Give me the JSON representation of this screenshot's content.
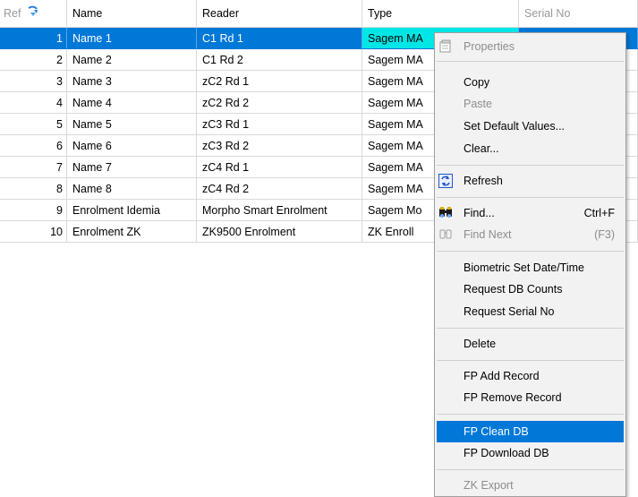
{
  "columns": {
    "ref": "Ref",
    "name": "Name",
    "reader": "Reader",
    "type": "Type",
    "serial": "Serial No"
  },
  "rows": [
    {
      "ref": "1",
      "name": "Name 1",
      "reader": "C1 Rd 1",
      "type": "Sagem MA"
    },
    {
      "ref": "2",
      "name": "Name 2",
      "reader": "C1 Rd 2",
      "type": "Sagem MA"
    },
    {
      "ref": "3",
      "name": "Name 3",
      "reader": "zC2 Rd 1",
      "type": "Sagem MA"
    },
    {
      "ref": "4",
      "name": "Name 4",
      "reader": "zC2 Rd 2",
      "type": "Sagem MA"
    },
    {
      "ref": "5",
      "name": "Name 5",
      "reader": "zC3 Rd 1",
      "type": "Sagem MA"
    },
    {
      "ref": "6",
      "name": "Name 6",
      "reader": "zC3 Rd 2",
      "type": "Sagem MA"
    },
    {
      "ref": "7",
      "name": "Name 7",
      "reader": "zC4 Rd 1",
      "type": "Sagem MA"
    },
    {
      "ref": "8",
      "name": "Name 8",
      "reader": "zC4 Rd 2",
      "type": "Sagem MA"
    },
    {
      "ref": "9",
      "name": "Enrolment Idemia",
      "reader": "Morpho Smart Enrolment",
      "type": "Sagem Mo"
    },
    {
      "ref": "10",
      "name": "Enrolment ZK",
      "reader": "ZK9500 Enrolment",
      "type": "ZK Enroll"
    }
  ],
  "selected_row": "1",
  "menu": {
    "properties": "Properties",
    "copy": "Copy",
    "paste": "Paste",
    "set_default": "Set Default Values...",
    "clear": "Clear...",
    "refresh": "Refresh",
    "find": "Find...",
    "find_shortcut": "Ctrl+F",
    "find_next": "Find Next",
    "find_next_shortcut": "(F3)",
    "biometric_date": "Biometric Set Date/Time",
    "request_db_counts": "Request DB Counts",
    "request_serial": "Request Serial No",
    "delete": "Delete",
    "fp_add": "FP Add Record",
    "fp_remove": "FP Remove Record",
    "fp_clean": "FP Clean DB",
    "fp_download": "FP Download DB",
    "zk_export": "ZK Export"
  },
  "colors": {
    "selection": "#0078d7",
    "type_cell_highlight": "#00e6e6",
    "menu_background": "#f2f2f2"
  }
}
